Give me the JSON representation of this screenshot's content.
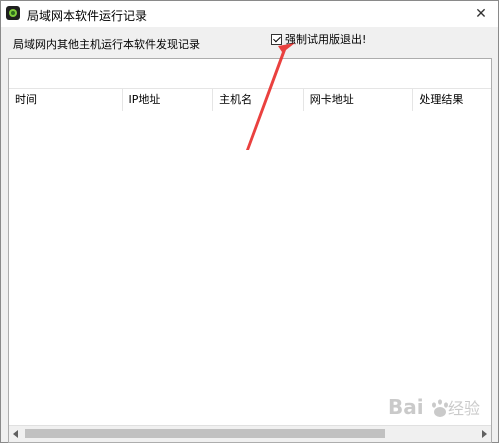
{
  "window": {
    "title": "局域网本软件运行记录",
    "close_glyph": "✕"
  },
  "description": "局域网内其他主机运行本软件发现记录",
  "checkbox": {
    "label": "强制试用版退出!",
    "checked": true
  },
  "table": {
    "columns": [
      "时间",
      "IP地址",
      "主机名",
      "网卡地址",
      "处理结果"
    ],
    "rows": []
  },
  "watermark": {
    "text": "Bai du 经验"
  },
  "colors": {
    "annotation_arrow": "#e8312f",
    "watermark": "#b9b9b9"
  }
}
